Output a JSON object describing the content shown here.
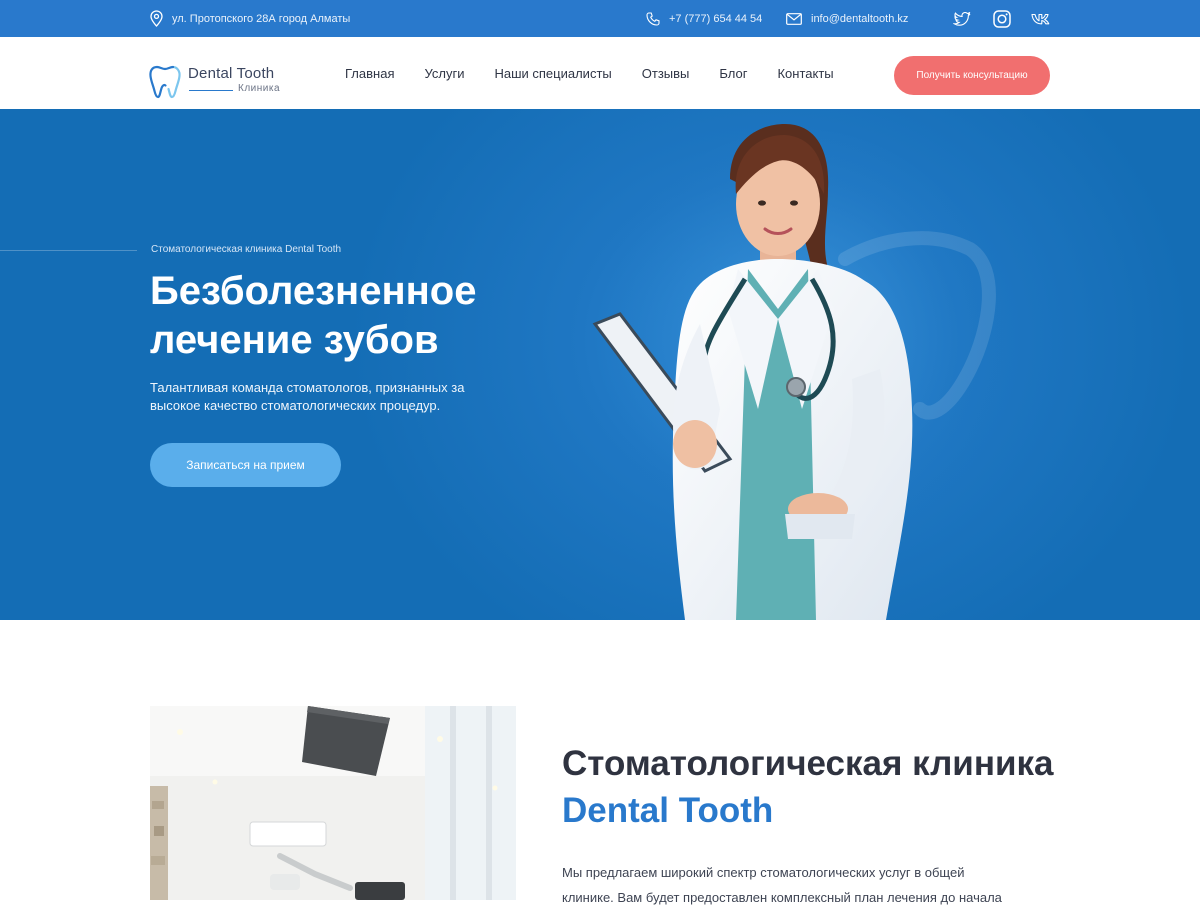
{
  "topbar": {
    "address": "ул. Протопского 28А город Алматы",
    "phone": "+7 (777) 654 44 54",
    "email": "info@dentaltooth.kz",
    "social": [
      "twitter-icon",
      "instagram-icon",
      "vk-icon"
    ]
  },
  "header": {
    "logo_name": "Dental Tooth",
    "logo_sub": "Клиника",
    "nav": [
      "Главная",
      "Услуги",
      "Наши специалисты",
      "Отзывы",
      "Блог",
      "Контакты"
    ],
    "cta_label": "Получить консультацию"
  },
  "hero": {
    "kicker": "Стоматологическая клиника Dental Tooth",
    "title_line1": "Безболезненное",
    "title_line2": "лечение зубов",
    "text": "Талантливая команда стоматологов, признанных за высокое качество стоматологических процедур.",
    "button_label": "Записаться на прием"
  },
  "about": {
    "title_line1": "Стоматологическая клиника",
    "title_brand": "Dental Tooth",
    "text": "Мы предлагаем широкий спектр стоматологических услуг в общей клинике. Вам будет предоставлен комплексный план лечения до начала"
  },
  "colors": {
    "primary": "#2979cc",
    "accent": "#f16f6f",
    "hero_button": "#5aaeeb",
    "text_dark": "#2f3340"
  }
}
